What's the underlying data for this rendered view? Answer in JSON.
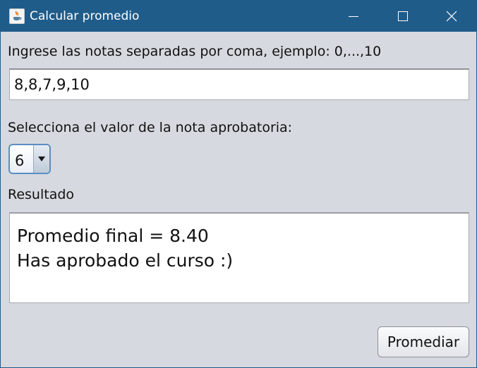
{
  "window": {
    "title": "Calcular promedio",
    "app_icon": "java-cup-icon",
    "controls": [
      "minimize-icon",
      "maximize-icon",
      "close-icon"
    ],
    "title_bar_color": "#1f5c8a"
  },
  "notas": {
    "label": "Ingrese las notas separadas por coma, ejemplo: 0,...,10",
    "value": "8,8,7,9,10"
  },
  "aprobatoria": {
    "label": "Selecciona el valor de la nota aprobatoria:",
    "selected": "6"
  },
  "resultado": {
    "label": "Resultado",
    "line1": "Promedio final = 8.40",
    "line2": "Has aprobado el curso :)"
  },
  "actions": {
    "promediar_label": "Promediar"
  }
}
